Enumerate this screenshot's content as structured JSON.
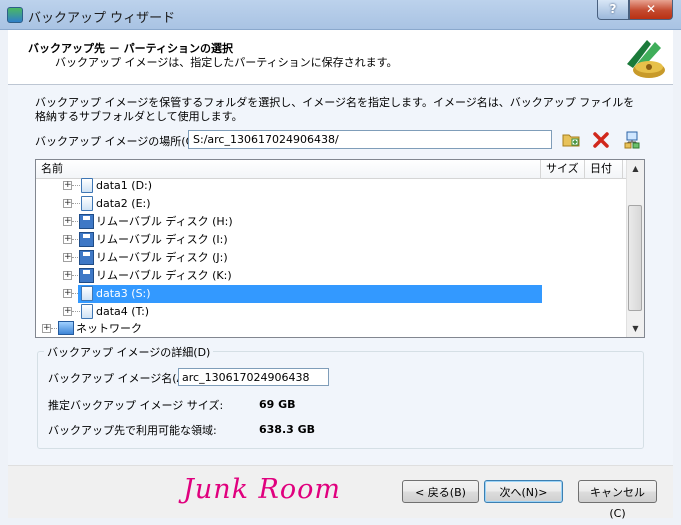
{
  "window": {
    "title": "バックアップ ウィザード",
    "help_label": "?",
    "close_label": "✕"
  },
  "header": {
    "title": "バックアップ先 － パーティションの選択",
    "subtitle": "バックアップ イメージは、指定したパーティションに保存されます。"
  },
  "instruction": "バックアップ イメージを保管するフォルダを選択し、イメージ名を指定します。イメージ名は、バックアップ ファイルを格納するサブフォルダとして使用します。",
  "location": {
    "label": "バックアップ イメージの場所(O):",
    "value": "S:/arc_130617024906438/"
  },
  "tree": {
    "columns": [
      "名前",
      "サイズ",
      "日付"
    ],
    "items": [
      {
        "label": "data1 (D:)",
        "icon": "drive-icon"
      },
      {
        "label": "data2 (E:)",
        "icon": "drive-icon"
      },
      {
        "label": "リムーバブル ディスク (H:)",
        "icon": "floppy-icon"
      },
      {
        "label": "リムーバブル ディスク (I:)",
        "icon": "floppy-icon"
      },
      {
        "label": "リムーバブル ディスク (J:)",
        "icon": "floppy-icon"
      },
      {
        "label": "リムーバブル ディスク (K:)",
        "icon": "floppy-icon"
      },
      {
        "label": "data3 (S:)",
        "icon": "drive-icon",
        "selected": true
      },
      {
        "label": "data4 (T:)",
        "icon": "drive-icon"
      }
    ],
    "network_label": "ネットワーク"
  },
  "details": {
    "group_title": "バックアップ イメージの詳細(D)",
    "name_label": "バックアップ イメージ名(A)",
    "name_value": "arc_130617024906438",
    "est_size_label": "推定バックアップ イメージ サイズ:",
    "est_size_value": "69 GB",
    "available_label": "バックアップ先で利用可能な領域:",
    "available_value": "638.3 GB"
  },
  "footer": {
    "logo_text": "Junk Room",
    "back_label": "< 戻る(B)",
    "next_label": "次へ(N)>",
    "cancel_label": "キャンセル(C)"
  },
  "colors": {
    "selection": "#3399ff",
    "logo_pink": "#e0007e"
  }
}
